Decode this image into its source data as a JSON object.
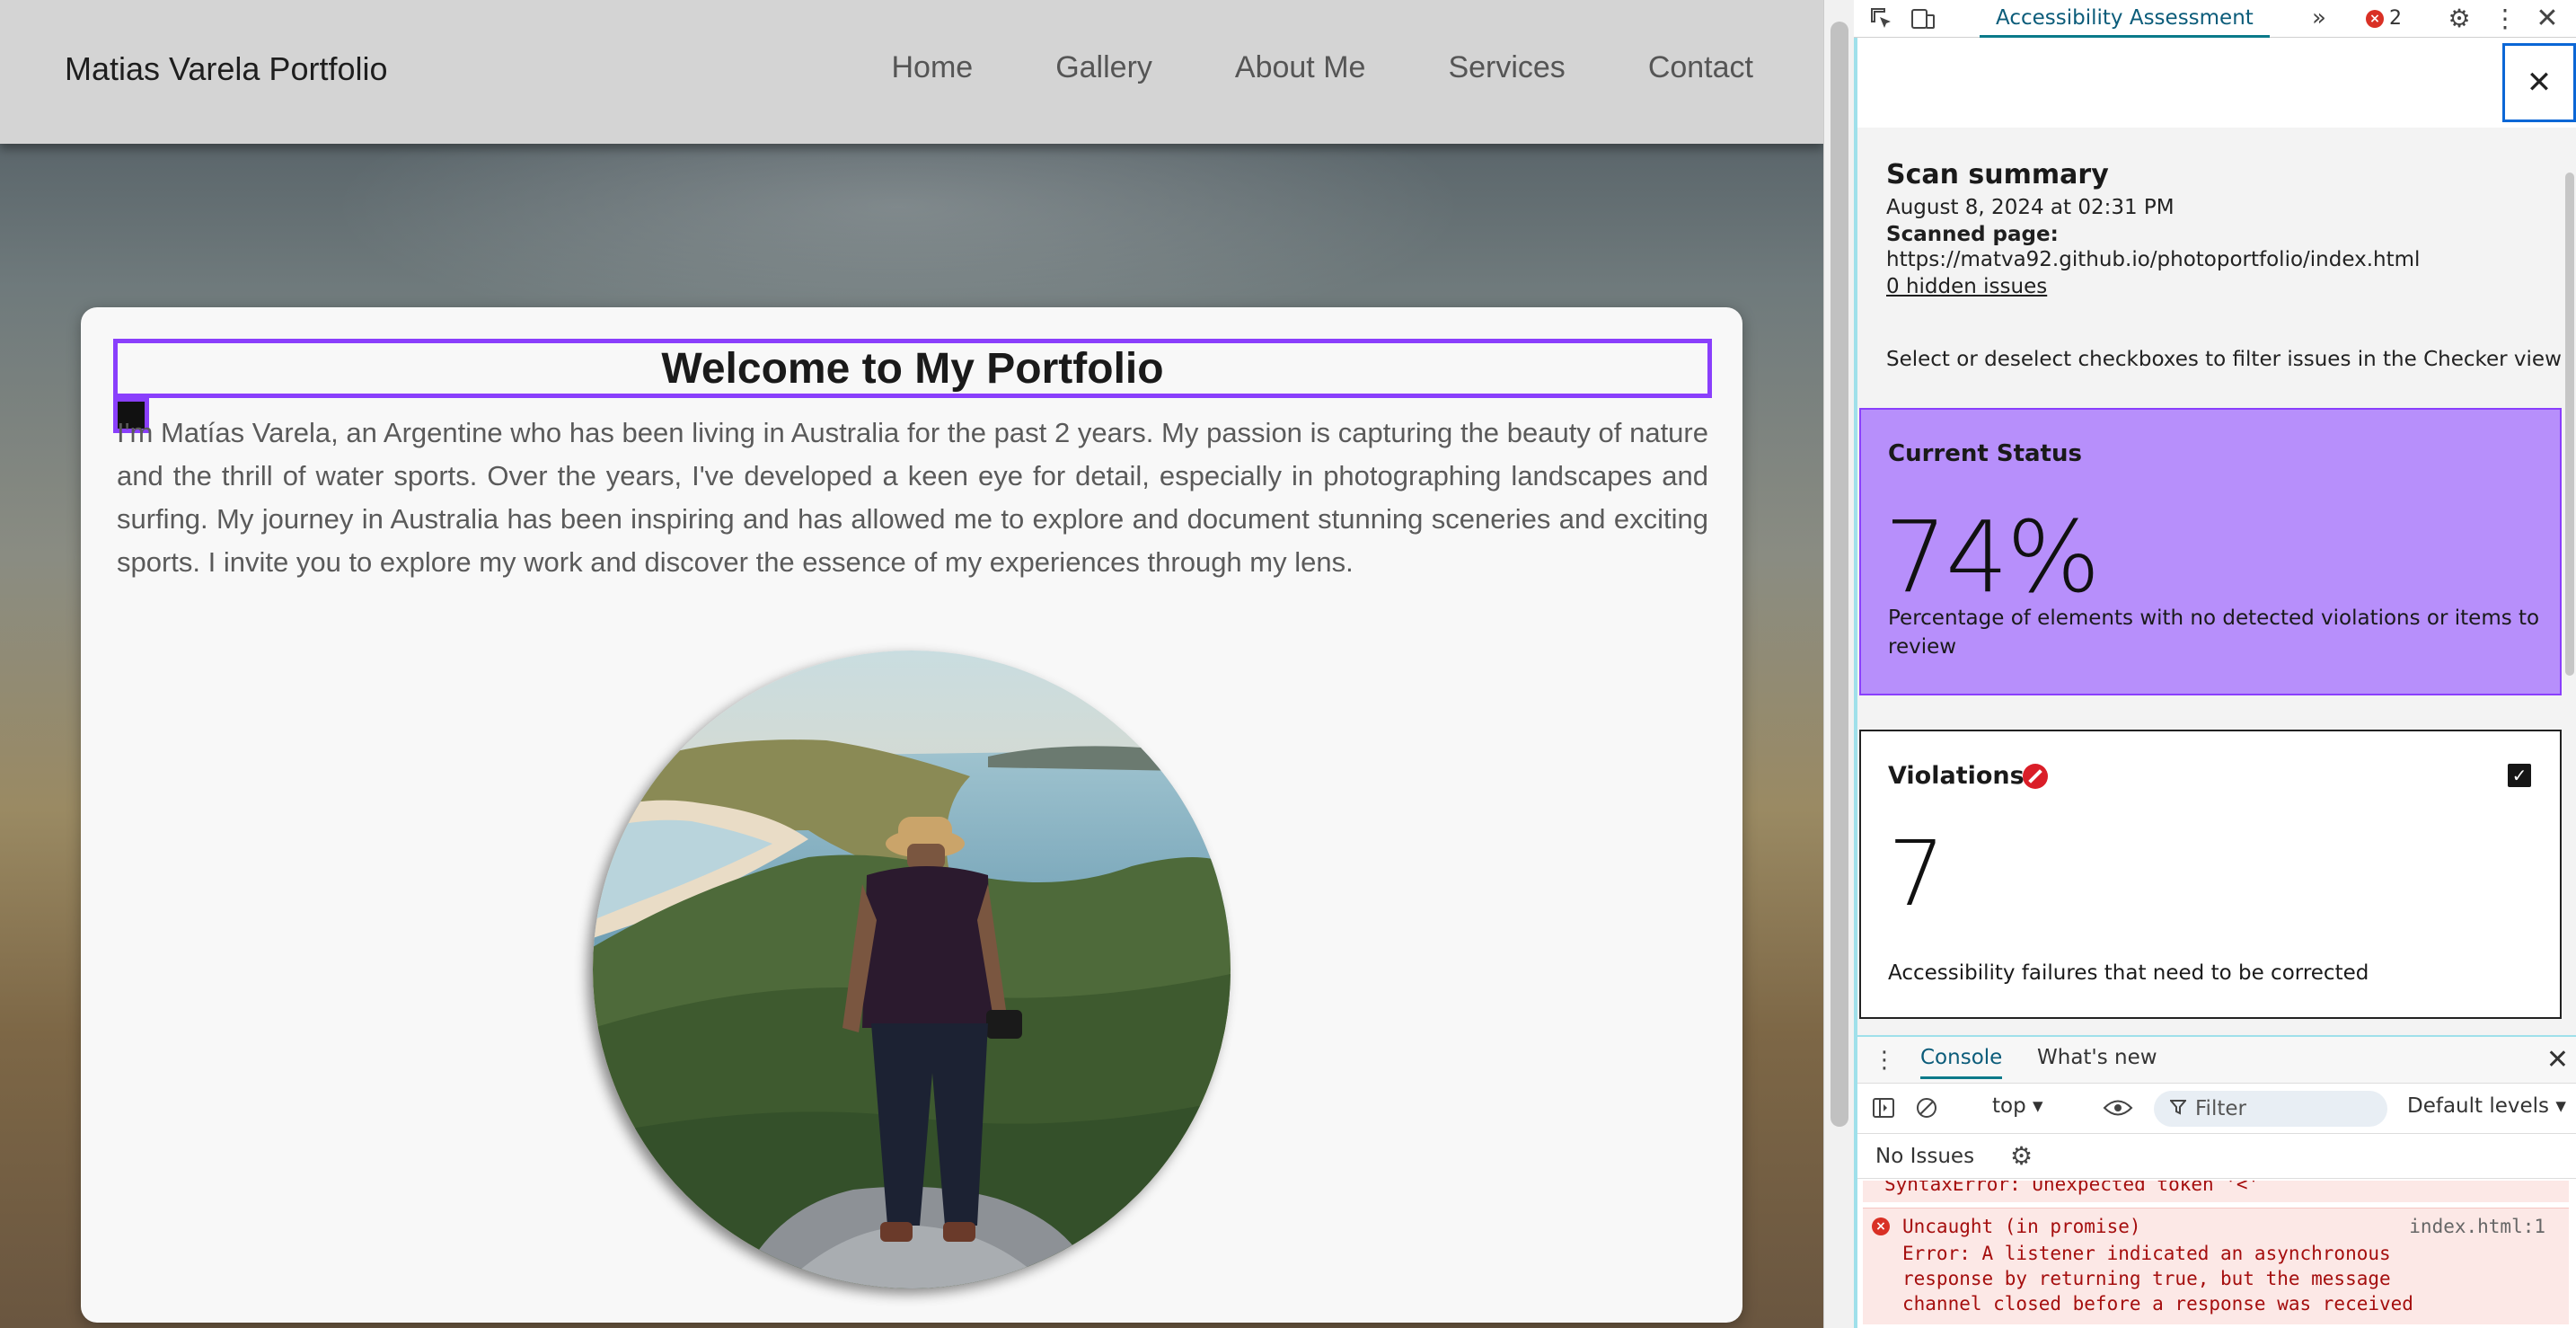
{
  "site": {
    "brand": "Matias Varela Portfolio",
    "nav": [
      "Home",
      "Gallery",
      "About Me",
      "Services",
      "Contact"
    ],
    "heading": "Welcome to My Portfolio",
    "intro": "I'm Matías Varela, an Argentine who has been living in Australia for the past 2 years. My passion is capturing the beauty of nature and the thrill of water sports. Over the years, I've developed a keen eye for detail, especially in photographing landscapes and surfing. My journey in Australia has been inspiring and has allowed me to explore and document stunning sceneries and exciting sports. I invite you to explore my work and discover the essence of my experiences through my lens."
  },
  "devtools": {
    "active_tab": "Accessibility Assessment",
    "error_count": "2",
    "summary": {
      "title": "Scan summary",
      "date": "August 8, 2024 at 02:31 PM",
      "scanned_label": "Scanned page:",
      "url": "https://matva92.github.io/photoportfolio/index.html",
      "hidden_issues": "0 hidden issues",
      "filter_note": "Select or deselect checkboxes to filter issues in the Checker view"
    },
    "status": {
      "title": "Current Status",
      "value": "74%",
      "description": "Percentage of elements with no detected violations or items to review"
    },
    "violations": {
      "title": "Violations",
      "value": "7",
      "description": "Accessibility failures that need to be corrected"
    },
    "drawer": {
      "tabs": [
        "Console",
        "What's new"
      ],
      "context": "top ▾",
      "filter_placeholder": "Filter",
      "levels": "Default levels ▾",
      "no_issues": "No Issues",
      "prev_message": "SyntaxError: Unexpected token '<'",
      "error_title": "Uncaught (in promise)",
      "error_source": "index.html:1",
      "error_body": "Error: A listener indicated an asynchronous response by returning true, but the message channel closed before a response was received"
    }
  },
  "colors": {
    "accent_purple": "#8a3ffc",
    "status_card": "#b78ffb",
    "error_red": "#d93025",
    "devtools_tab": "#0b5c7a"
  }
}
